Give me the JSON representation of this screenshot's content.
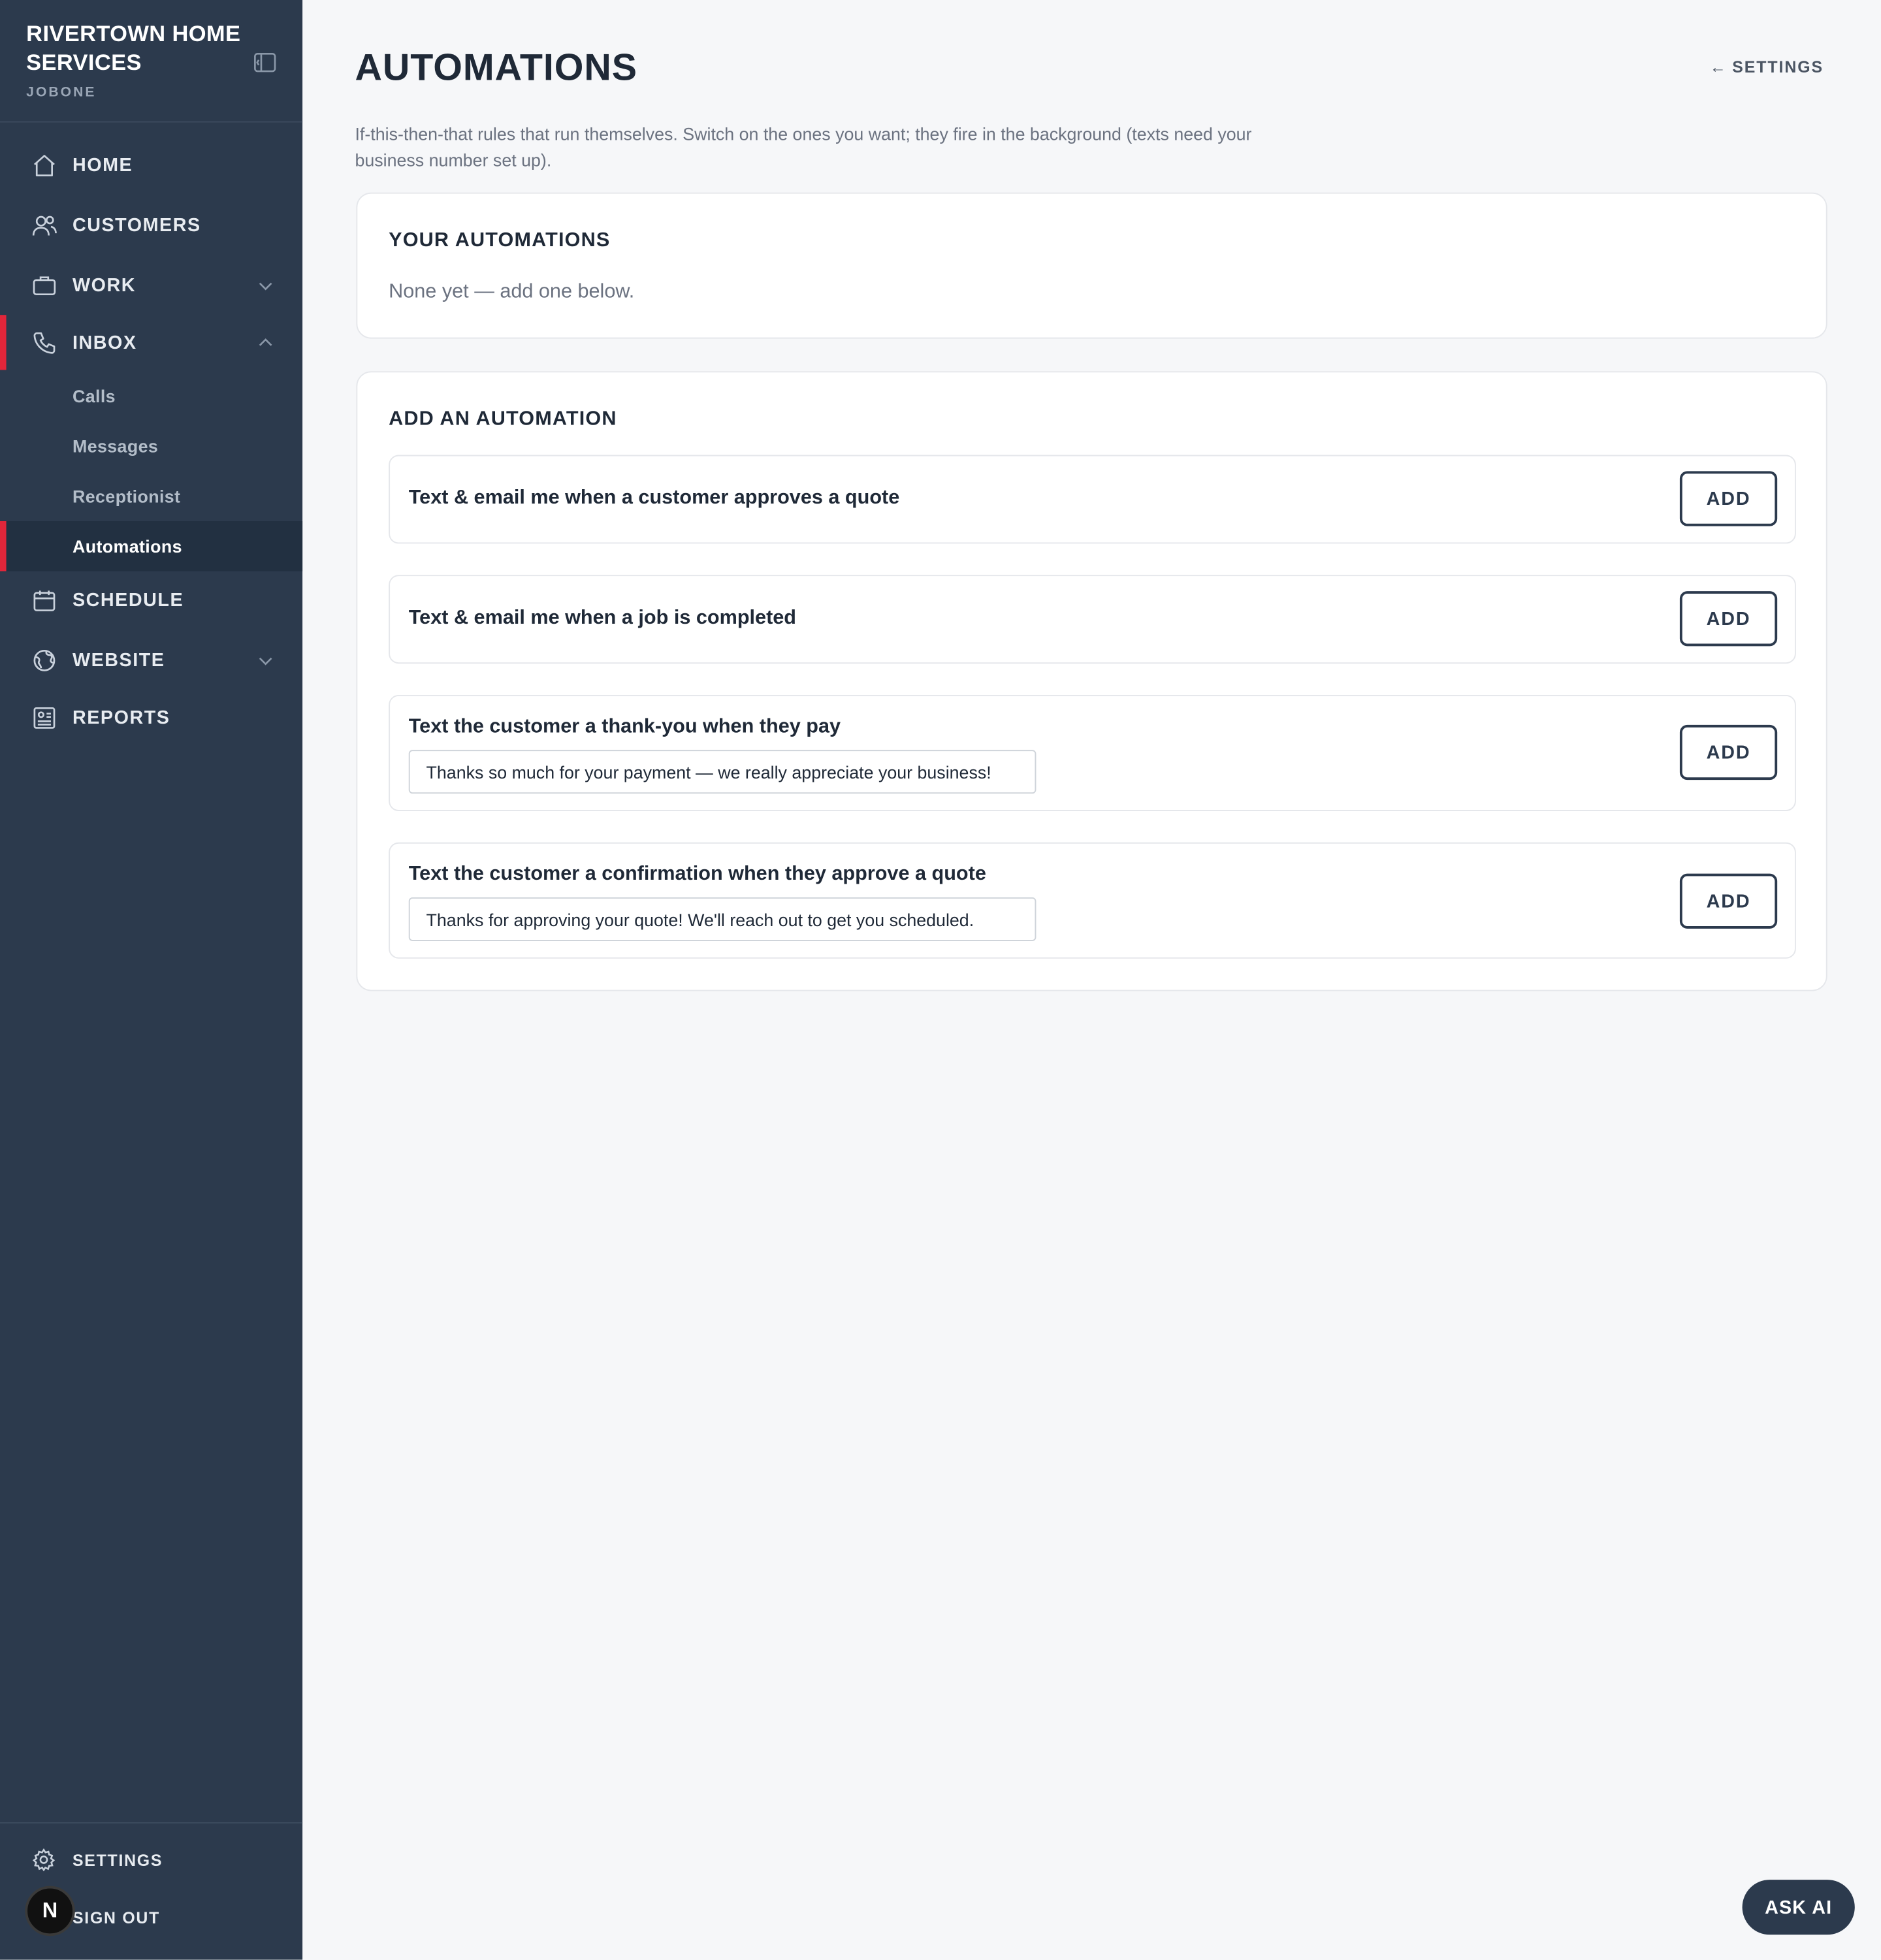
{
  "brand": {
    "name": "RIVERTOWN HOME SERVICES",
    "subtitle": "JOBONE"
  },
  "nav": {
    "home": "HOME",
    "customers": "CUSTOMERS",
    "work": "WORK",
    "inbox": "INBOX",
    "inbox_children": {
      "calls": "Calls",
      "messages": "Messages",
      "receptionist": "Receptionist",
      "automations": "Automations"
    },
    "schedule": "SCHEDULE",
    "website": "WEBSITE",
    "reports": "REPORTS"
  },
  "footer": {
    "settings": "SETTINGS",
    "sign_out": "SIGN OUT",
    "avatar_letter": "N"
  },
  "page": {
    "title": "AUTOMATIONS",
    "back_arrow": "←",
    "back_label": "SETTINGS",
    "intro": "If-this-then-that rules that run themselves. Switch on the ones you want; they fire in the background (texts need your business number set up)."
  },
  "your_automations": {
    "title": "YOUR AUTOMATIONS",
    "empty": "None yet — add one below."
  },
  "add_automation": {
    "title": "ADD AN AUTOMATION",
    "rules": [
      {
        "title": "Text & email me when a customer approves a quote",
        "button": "ADD"
      },
      {
        "title": "Text & email me when a job is completed",
        "button": "ADD"
      },
      {
        "title": "Text the customer a thank-you when they pay",
        "message": "Thanks so much for your payment — we really appreciate your business!",
        "button": "ADD"
      },
      {
        "title": "Text the customer a confirmation when they approve a quote",
        "message": "Thanks for approving your quote! We'll reach out to get you scheduled.",
        "button": "ADD"
      }
    ]
  },
  "ask_ai": "ASK AI",
  "colors": {
    "sidebar": "#2c3a4d",
    "accent": "#e1263a",
    "background": "#f6f7f9"
  }
}
